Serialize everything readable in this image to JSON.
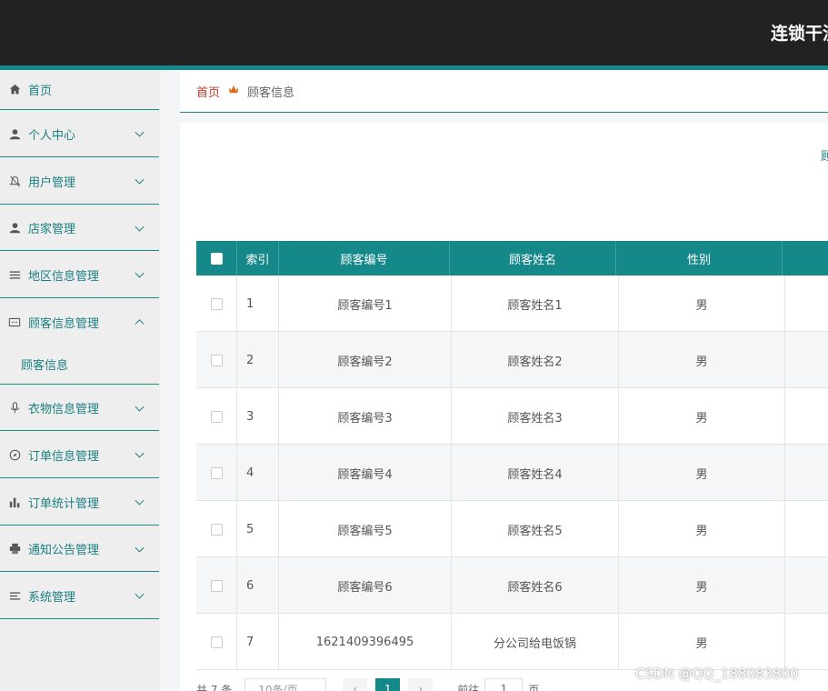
{
  "header": {
    "app_title": "连锁干洗"
  },
  "sidebar": {
    "items": [
      {
        "label": "首页",
        "icon": "home-icon",
        "expandable": false
      },
      {
        "label": "个人中心",
        "icon": "user-icon",
        "expandable": true
      },
      {
        "label": "用户管理",
        "icon": "bell-icon",
        "expandable": true
      },
      {
        "label": "店家管理",
        "icon": "user-icon",
        "expandable": true
      },
      {
        "label": "地区信息管理",
        "icon": "list-icon",
        "expandable": true
      },
      {
        "label": "顾客信息管理",
        "icon": "message-icon",
        "expandable": true,
        "expanded": true
      },
      {
        "label": "衣物信息管理",
        "icon": "microphone-icon",
        "expandable": true
      },
      {
        "label": "订单信息管理",
        "icon": "compass-icon",
        "expandable": true
      },
      {
        "label": "订单统计管理",
        "icon": "bar-chart-icon",
        "expandable": true
      },
      {
        "label": "通知公告管理",
        "icon": "printer-icon",
        "expandable": true
      },
      {
        "label": "系统管理",
        "icon": "menu-icon",
        "expandable": true
      }
    ],
    "sub_items": {
      "customer": "顾客信息"
    }
  },
  "breadcrumb": {
    "home": "首页",
    "current": "顾客信息"
  },
  "search": {
    "label": "顾"
  },
  "table": {
    "columns": [
      "索引",
      "顾客编号",
      "顾客姓名",
      "性别"
    ],
    "rows": [
      {
        "index": "1",
        "code": "顾客编号1",
        "name": "顾客姓名1",
        "gender": "男"
      },
      {
        "index": "2",
        "code": "顾客编号2",
        "name": "顾客姓名2",
        "gender": "男"
      },
      {
        "index": "3",
        "code": "顾客编号3",
        "name": "顾客姓名3",
        "gender": "男"
      },
      {
        "index": "4",
        "code": "顾客编号4",
        "name": "顾客姓名4",
        "gender": "男"
      },
      {
        "index": "5",
        "code": "顾客编号5",
        "name": "顾客姓名5",
        "gender": "男"
      },
      {
        "index": "6",
        "code": "顾客编号6",
        "name": "顾客姓名6",
        "gender": "男"
      },
      {
        "index": "7",
        "code": "1621409396495",
        "name": "分公司给电饭锅",
        "gender": "男"
      }
    ]
  },
  "pagination": {
    "total": "共 7 条",
    "page_size": "10条/页",
    "prev": "‹",
    "current_page": "1",
    "next": "›",
    "goto": "前往",
    "goto_value": "1",
    "page_unit": "页"
  },
  "watermark": "CSDN @QQ_188083800",
  "colors": {
    "accent": "#15888a",
    "topbar": "#222222",
    "sidebar_text": "#1a7f81",
    "breadcrumb_home": "#c0392b"
  }
}
